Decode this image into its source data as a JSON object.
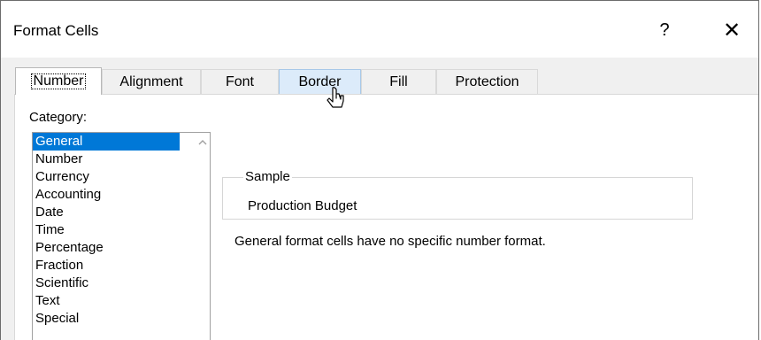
{
  "window": {
    "title": "Format Cells",
    "help_glyph": "?",
    "close_glyph": "✕"
  },
  "tabs": [
    {
      "label": "Number",
      "state": "active"
    },
    {
      "label": "Alignment",
      "state": "normal"
    },
    {
      "label": "Font",
      "state": "normal"
    },
    {
      "label": "Border",
      "state": "hover"
    },
    {
      "label": "Fill",
      "state": "normal"
    },
    {
      "label": "Protection",
      "state": "normal"
    }
  ],
  "category": {
    "label": "Category:",
    "selected": "General",
    "items": [
      "General",
      "Number",
      "Currency",
      "Accounting",
      "Date",
      "Time",
      "Percentage",
      "Fraction",
      "Scientific",
      "Text",
      "Special"
    ]
  },
  "sample": {
    "legend": "Sample",
    "value": "Production Budget"
  },
  "description": "General format cells have no specific number format.",
  "colors": {
    "selection": "#0078d7",
    "tab_hover": "#dcebfa",
    "dialog_bg": "#f0f0f0"
  }
}
